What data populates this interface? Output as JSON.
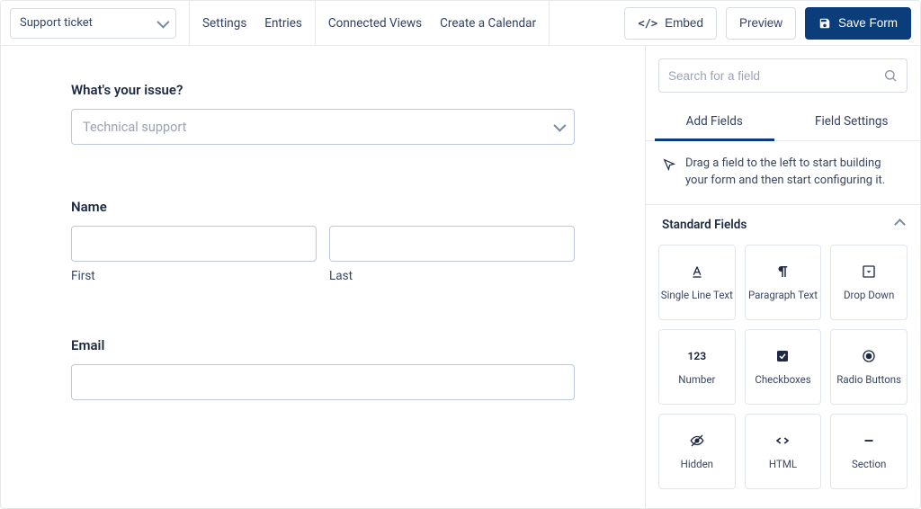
{
  "toolbar": {
    "form_selector": "Support ticket",
    "settings": "Settings",
    "entries": "Entries",
    "connected_views": "Connected Views",
    "create_calendar": "Create a Calendar",
    "embed": "Embed",
    "preview": "Preview",
    "save_form": "Save Form"
  },
  "form": {
    "issue": {
      "label": "What's your issue?",
      "placeholder": "Technical support"
    },
    "name": {
      "label": "Name",
      "first_sublabel": "First",
      "last_sublabel": "Last"
    },
    "email": {
      "label": "Email"
    }
  },
  "sidebar": {
    "search_placeholder": "Search for a field",
    "tab_add": "Add Fields",
    "tab_settings": "Field Settings",
    "hint": "Drag a field to the left to start building your form and then start configuring it.",
    "section_title": "Standard Fields",
    "tiles": {
      "single_line": "Single Line Text",
      "paragraph": "Paragraph Text",
      "dropdown": "Drop Down",
      "number": "Number",
      "number_icon": "123",
      "checkboxes": "Checkboxes",
      "radio": "Radio Buttons",
      "hidden": "Hidden",
      "html": "HTML",
      "section": "Section"
    }
  }
}
